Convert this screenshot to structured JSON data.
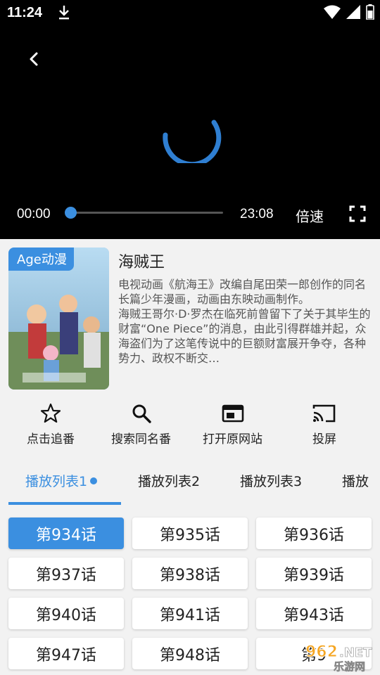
{
  "status_bar": {
    "time": "11:24"
  },
  "player": {
    "current_time": "00:00",
    "duration": "23:08",
    "progress": 0.02,
    "speed_label": "倍速",
    "accent": "#3b8fe0"
  },
  "anime": {
    "cover_tag": "Age动漫",
    "title": "海贼王",
    "description": "电视动画《航海王》改编自尾田荣一郎创作的同名长篇少年漫画，动画由东映动画制作。\n海贼王哥尔·D·罗杰在临死前曾留下了关于其毕生的财富“One Piece”的消息，由此引得群雄并起，众海盗们为了这笔传说中的巨额财富展开争夺，各种势力、政权不断交…"
  },
  "actions": [
    {
      "label": "点击追番",
      "icon": "star-outline-icon"
    },
    {
      "label": "搜索同名番",
      "icon": "search-icon"
    },
    {
      "label": "打开原网站",
      "icon": "browser-window-icon"
    },
    {
      "label": "投屏",
      "icon": "cast-icon"
    }
  ],
  "tabs": [
    {
      "label": "播放列表1"
    },
    {
      "label": "播放列表2"
    },
    {
      "label": "播放列表3"
    },
    {
      "label": "播放"
    }
  ],
  "episodes": [
    "第934话",
    "第935话",
    "第936话",
    "第937话",
    "第938话",
    "第939话",
    "第940话",
    "第941话",
    "第943话",
    "第947话",
    "第948话",
    "第9"
  ],
  "watermark": {
    "number": "962",
    "domain": "NET",
    "name": "乐游网"
  }
}
